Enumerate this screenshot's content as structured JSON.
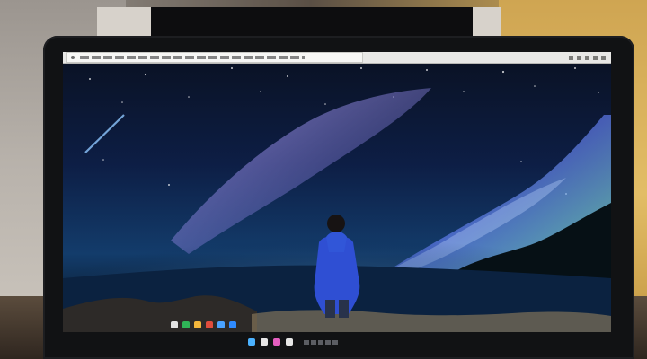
{
  "colors": {
    "screen_sky": "#08101f",
    "aurora_blue": "#5f6dff",
    "aurora_green": "#7ff0a8",
    "milky_way_purple": "#8b7bd8",
    "horizon_glow": "#d7f4ff",
    "person_jacket": "#2f4fd3",
    "taskbar_dark": "#171717"
  },
  "icons": {
    "taskbar": [
      {
        "name": "app-icon-1",
        "color": "#e3e3e3"
      },
      {
        "name": "app-icon-2",
        "color": "#2fb457"
      },
      {
        "name": "app-icon-3",
        "color": "#f4b63b"
      },
      {
        "name": "app-icon-4",
        "color": "#df4d3d"
      },
      {
        "name": "app-icon-5",
        "color": "#4aa3ff"
      },
      {
        "name": "app-icon-6",
        "color": "#2f8bff"
      }
    ],
    "bezel": [
      {
        "name": "bezel-icon-1",
        "color": "#4bb2ff"
      },
      {
        "name": "bezel-icon-2",
        "color": "#e7e7e7"
      },
      {
        "name": "bezel-icon-3",
        "color": "#e45ec0"
      },
      {
        "name": "bezel-icon-4",
        "color": "#e7e7e7"
      }
    ]
  }
}
